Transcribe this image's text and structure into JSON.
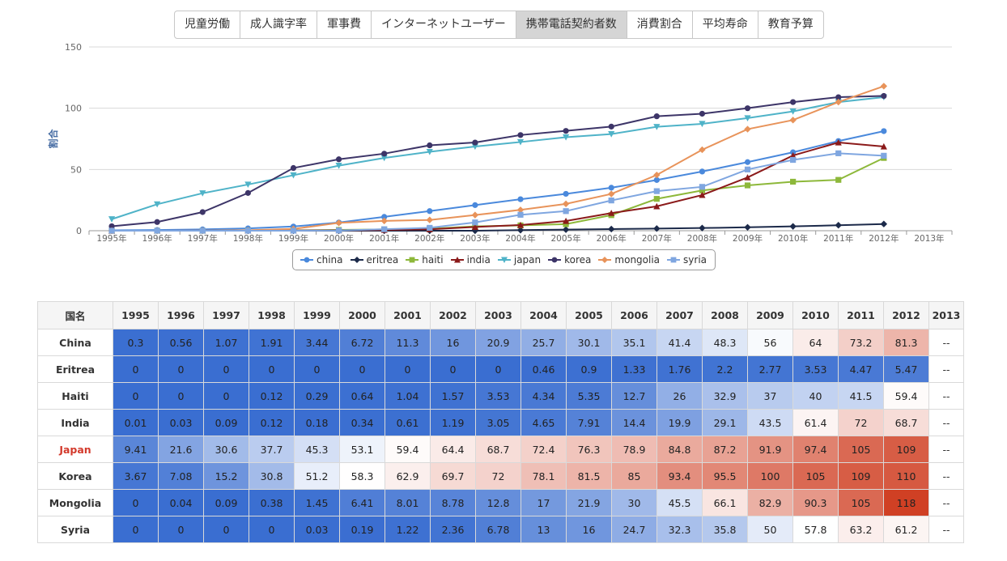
{
  "tabs": [
    {
      "label": "児童労働",
      "active": false
    },
    {
      "label": "成人識字率",
      "active": false
    },
    {
      "label": "軍事費",
      "active": false
    },
    {
      "label": "インターネットユーザー",
      "active": false
    },
    {
      "label": "携帯電話契約者数",
      "active": true
    },
    {
      "label": "消費割合",
      "active": false
    },
    {
      "label": "平均寿命",
      "active": false
    },
    {
      "label": "教育予算",
      "active": false
    }
  ],
  "chart_data": {
    "type": "line",
    "ylabel": "割合",
    "ylim": [
      0,
      150
    ],
    "yticks": [
      "0",
      "50",
      "100",
      "150"
    ],
    "categories": [
      "1995年",
      "1996年",
      "1997年",
      "1998年",
      "1999年",
      "2000年",
      "2001年",
      "2002年",
      "2003年",
      "2004年",
      "2005年",
      "2006年",
      "2007年",
      "2008年",
      "2009年",
      "2010年",
      "2011年",
      "2012年",
      "2013年"
    ],
    "grid": true,
    "legend_position": "bottom-center",
    "series": [
      {
        "name": "china",
        "color": "#4a89dc",
        "marker": "circle",
        "values": [
          0.3,
          0.56,
          1.07,
          1.91,
          3.44,
          6.72,
          11.3,
          16,
          20.9,
          25.7,
          30.1,
          35.1,
          41.4,
          48.3,
          56,
          64,
          73.2,
          81.3,
          null
        ]
      },
      {
        "name": "eritrea",
        "color": "#1c2a4a",
        "marker": "diamond",
        "values": [
          0,
          0,
          0,
          0,
          0,
          0,
          0,
          0,
          0,
          0.46,
          0.9,
          1.33,
          1.76,
          2.2,
          2.77,
          3.53,
          4.47,
          5.47,
          null
        ]
      },
      {
        "name": "haiti",
        "color": "#8db83a",
        "marker": "square",
        "values": [
          0,
          0,
          0,
          0.12,
          0.29,
          0.64,
          1.04,
          1.57,
          3.53,
          4.34,
          5.35,
          12.7,
          26,
          32.9,
          37,
          40,
          41.5,
          59.4,
          null
        ]
      },
      {
        "name": "india",
        "color": "#8b1a1a",
        "marker": "triangle",
        "values": [
          0.01,
          0.03,
          0.09,
          0.12,
          0.18,
          0.34,
          0.61,
          1.19,
          3.05,
          4.65,
          7.91,
          14.4,
          19.9,
          29.1,
          43.5,
          61.4,
          72,
          68.7,
          null
        ]
      },
      {
        "name": "japan",
        "color": "#4fb3c8",
        "marker": "triangle-down",
        "values": [
          9.41,
          21.6,
          30.6,
          37.7,
          45.3,
          53.1,
          59.4,
          64.4,
          68.7,
          72.4,
          76.3,
          78.9,
          84.8,
          87.2,
          91.9,
          97.4,
          105,
          109,
          null
        ]
      },
      {
        "name": "korea",
        "color": "#3d3568",
        "marker": "circle",
        "values": [
          3.67,
          7.08,
          15.2,
          30.8,
          51.2,
          58.3,
          62.9,
          69.7,
          72,
          78.1,
          81.5,
          85,
          93.4,
          95.5,
          100,
          105,
          109,
          110,
          null
        ]
      },
      {
        "name": "mongolia",
        "color": "#e8935a",
        "marker": "diamond",
        "values": [
          0,
          0.04,
          0.09,
          0.38,
          1.45,
          6.41,
          8.01,
          8.78,
          12.8,
          17,
          21.9,
          30,
          45.5,
          66.1,
          82.9,
          90.3,
          105,
          118,
          null
        ]
      },
      {
        "name": "syria",
        "color": "#7fa6e0",
        "marker": "square",
        "values": [
          0,
          0,
          0,
          0,
          0.03,
          0.19,
          1.22,
          2.36,
          6.78,
          13,
          16,
          24.7,
          32.3,
          35.8,
          50,
          57.8,
          63.2,
          61.2,
          null
        ]
      }
    ]
  },
  "table": {
    "header_name": "国名",
    "years": [
      "1995",
      "1996",
      "1997",
      "1998",
      "1999",
      "2000",
      "2001",
      "2002",
      "2003",
      "2004",
      "2005",
      "2006",
      "2007",
      "2008",
      "2009",
      "2010",
      "2011",
      "2012",
      "2013"
    ],
    "highlight_row": "Japan",
    "rows": [
      {
        "name": "China",
        "cells": [
          "0.3",
          "0.56",
          "1.07",
          "1.91",
          "3.44",
          "6.72",
          "11.3",
          "16",
          "20.9",
          "25.7",
          "30.1",
          "35.1",
          "41.4",
          "48.3",
          "56",
          "64",
          "73.2",
          "81.3",
          "--"
        ]
      },
      {
        "name": "Eritrea",
        "cells": [
          "0",
          "0",
          "0",
          "0",
          "0",
          "0",
          "0",
          "0",
          "0",
          "0.46",
          "0.9",
          "1.33",
          "1.76",
          "2.2",
          "2.77",
          "3.53",
          "4.47",
          "5.47",
          "--"
        ]
      },
      {
        "name": "Haiti",
        "cells": [
          "0",
          "0",
          "0",
          "0.12",
          "0.29",
          "0.64",
          "1.04",
          "1.57",
          "3.53",
          "4.34",
          "5.35",
          "12.7",
          "26",
          "32.9",
          "37",
          "40",
          "41.5",
          "59.4",
          "--"
        ]
      },
      {
        "name": "India",
        "cells": [
          "0.01",
          "0.03",
          "0.09",
          "0.12",
          "0.18",
          "0.34",
          "0.61",
          "1.19",
          "3.05",
          "4.65",
          "7.91",
          "14.4",
          "19.9",
          "29.1",
          "43.5",
          "61.4",
          "72",
          "68.7",
          "--"
        ]
      },
      {
        "name": "Japan",
        "cells": [
          "9.41",
          "21.6",
          "30.6",
          "37.7",
          "45.3",
          "53.1",
          "59.4",
          "64.4",
          "68.7",
          "72.4",
          "76.3",
          "78.9",
          "84.8",
          "87.2",
          "91.9",
          "97.4",
          "105",
          "109",
          "--"
        ]
      },
      {
        "name": "Korea",
        "cells": [
          "3.67",
          "7.08",
          "15.2",
          "30.8",
          "51.2",
          "58.3",
          "62.9",
          "69.7",
          "72",
          "78.1",
          "81.5",
          "85",
          "93.4",
          "95.5",
          "100",
          "105",
          "109",
          "110",
          "--"
        ]
      },
      {
        "name": "Mongolia",
        "cells": [
          "0",
          "0.04",
          "0.09",
          "0.38",
          "1.45",
          "6.41",
          "8.01",
          "8.78",
          "12.8",
          "17",
          "21.9",
          "30",
          "45.5",
          "66.1",
          "82.9",
          "90.3",
          "105",
          "118",
          "--"
        ]
      },
      {
        "name": "Syria",
        "cells": [
          "0",
          "0",
          "0",
          "0",
          "0.03",
          "0.19",
          "1.22",
          "2.36",
          "6.78",
          "13",
          "16",
          "24.7",
          "32.3",
          "35.8",
          "50",
          "57.8",
          "63.2",
          "61.2",
          "--"
        ]
      }
    ]
  }
}
